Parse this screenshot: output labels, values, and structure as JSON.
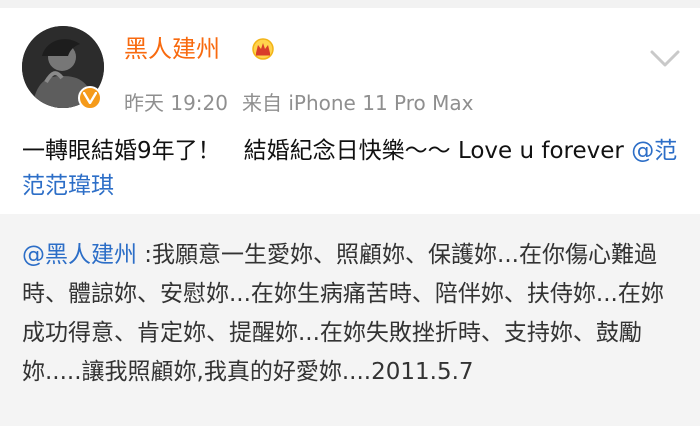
{
  "post": {
    "username": "黑人建州",
    "time": "昨天 19:20",
    "source": "来自 iPhone 11 Pro Max",
    "text": "一轉眼結婚9年了！　結婚紀念日快樂～～ Love u forever ",
    "mention": "@范范范瑋琪"
  },
  "repost": {
    "mention": "@黑人建州",
    "text": " :我願意一生愛妳、照顧妳、保護妳...在你傷心難過時、體諒妳、安慰妳...在妳生病痛苦時、陪伴妳、扶侍妳...在妳成功得意、肯定妳、提醒妳...在妳失敗挫折時、支持妳、鼓勵妳.....讓我照顧妳,我真的好愛妳....2011.5.7"
  },
  "colors": {
    "username": "#f86a0f",
    "link": "#2c6ec7",
    "meta": "#8f8f8f",
    "repost_bg": "#f4f4f4"
  },
  "icons": [
    "avatar",
    "verified-badge-icon",
    "crown-icon",
    "chevron-down-icon"
  ]
}
